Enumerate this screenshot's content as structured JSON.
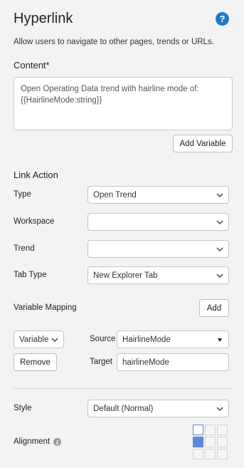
{
  "header": {
    "title": "Hyperlink",
    "help_icon": "question-circle-icon",
    "description": "Allow users to navigate to other pages, trends or URLs."
  },
  "content": {
    "label": "Content*",
    "value_line1": "Open Operating Data trend with hairline mode of:",
    "value_line2": "{{HairlineMode:string}}",
    "add_variable": "Add Variable"
  },
  "link_action": {
    "heading": "Link Action",
    "type_label": "Type",
    "type_value": "Open Trend",
    "workspace_label": "Workspace",
    "workspace_value": "",
    "trend_label": "Trend",
    "trend_value": "",
    "tab_type_label": "Tab Type",
    "tab_type_value": "New Explorer Tab",
    "variable_mapping_label": "Variable Mapping",
    "add": "Add",
    "mapping": {
      "kind": "Variable",
      "source_label": "Source",
      "source_value": "HairlineMode",
      "remove": "Remove",
      "target_label": "Target",
      "target_value": "hairlineMode"
    }
  },
  "style": {
    "label": "Style",
    "value": "Default (Normal)"
  },
  "alignment": {
    "label": "Alignment",
    "info_icon": "info-icon",
    "selected": "middle-left",
    "accent": "#5b8ad6"
  },
  "colors": {
    "background": "#f3f3f3",
    "help": "#1f7bc4"
  }
}
